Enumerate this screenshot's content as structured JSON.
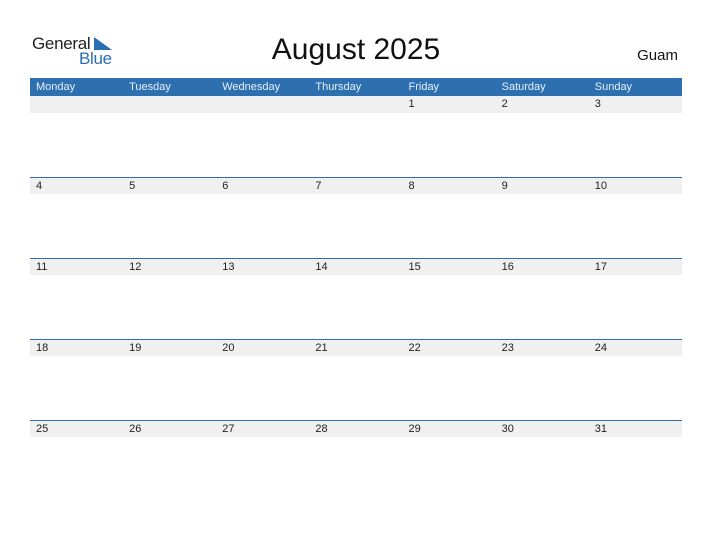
{
  "logo": {
    "line1": "General",
    "line2": "Blue"
  },
  "title": "August 2025",
  "country": "Guam",
  "colors": {
    "accent": "#2e6fb0",
    "band": "#f0f0f0"
  },
  "weekdays": [
    "Monday",
    "Tuesday",
    "Wednesday",
    "Thursday",
    "Friday",
    "Saturday",
    "Sunday"
  ],
  "weeks": [
    [
      "",
      "",
      "",
      "",
      "1",
      "2",
      "3"
    ],
    [
      "4",
      "5",
      "6",
      "7",
      "8",
      "9",
      "10"
    ],
    [
      "11",
      "12",
      "13",
      "14",
      "15",
      "16",
      "17"
    ],
    [
      "18",
      "19",
      "20",
      "21",
      "22",
      "23",
      "24"
    ],
    [
      "25",
      "26",
      "27",
      "28",
      "29",
      "30",
      "31"
    ]
  ]
}
